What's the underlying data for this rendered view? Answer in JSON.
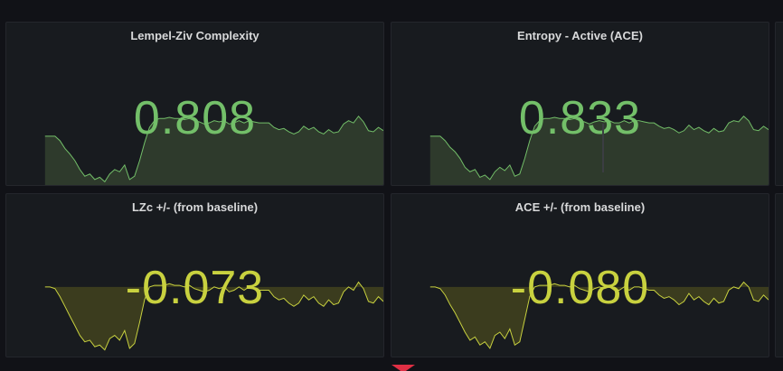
{
  "panels": {
    "lzc": {
      "title": "Lempel-Ziv Complexity",
      "value": "0.808",
      "color": "#73bf69",
      "fill": "#2e3a2c",
      "series": [
        0.44,
        0.44,
        0.44,
        0.4,
        0.33,
        0.28,
        0.22,
        0.14,
        0.08,
        0.1,
        0.05,
        0.07,
        0.03,
        0.1,
        0.14,
        0.12,
        0.18,
        0.05,
        0.08,
        0.22,
        0.38,
        0.52,
        0.58,
        0.6,
        0.6,
        0.61,
        0.6,
        0.6,
        0.59,
        0.6,
        0.58,
        0.57,
        0.55,
        0.56,
        0.58,
        0.57,
        0.58,
        0.55,
        0.56,
        0.58,
        0.56,
        0.58,
        0.57,
        0.56,
        0.56,
        0.56,
        0.52,
        0.5,
        0.51,
        0.48,
        0.46,
        0.48,
        0.53,
        0.5,
        0.52,
        0.48,
        0.46,
        0.5,
        0.47,
        0.48,
        0.55,
        0.58,
        0.56,
        0.62,
        0.57,
        0.49,
        0.48,
        0.52,
        0.49
      ]
    },
    "ace": {
      "title": "Entropy - Active (ACE)",
      "value": "0.833",
      "color": "#73bf69",
      "fill": "#2e3a2c",
      "series": [
        0.44,
        0.44,
        0.44,
        0.4,
        0.34,
        0.3,
        0.24,
        0.16,
        0.12,
        0.14,
        0.07,
        0.09,
        0.05,
        0.12,
        0.16,
        0.13,
        0.18,
        0.08,
        0.1,
        0.24,
        0.4,
        0.53,
        0.58,
        0.6,
        0.6,
        0.61,
        0.6,
        0.6,
        0.59,
        0.6,
        0.58,
        0.57,
        0.55,
        0.57,
        0.58,
        0.57,
        0.58,
        0.56,
        0.56,
        0.58,
        0.56,
        0.58,
        0.58,
        0.57,
        0.56,
        0.56,
        0.53,
        0.51,
        0.52,
        0.5,
        0.47,
        0.49,
        0.54,
        0.5,
        0.52,
        0.49,
        0.47,
        0.51,
        0.48,
        0.49,
        0.56,
        0.58,
        0.57,
        0.62,
        0.58,
        0.5,
        0.49,
        0.53,
        0.5
      ]
    },
    "lzc_delta": {
      "title": "LZc +/- (from baseline)",
      "value": "-0.073",
      "color": "#c8d13f",
      "fill": "#3b3c1e",
      "baseline": 0.0,
      "series": [
        0.0,
        0.0,
        -0.01,
        -0.06,
        -0.12,
        -0.18,
        -0.24,
        -0.3,
        -0.34,
        -0.33,
        -0.37,
        -0.36,
        -0.39,
        -0.32,
        -0.3,
        -0.33,
        -0.27,
        -0.38,
        -0.35,
        -0.22,
        -0.08,
        0.0,
        0.01,
        0.01,
        0.01,
        0.02,
        0.01,
        0.01,
        0.0,
        0.01,
        -0.01,
        -0.02,
        -0.03,
        -0.02,
        0.0,
        -0.01,
        0.0,
        -0.03,
        -0.02,
        0.0,
        -0.02,
        0.0,
        -0.01,
        -0.02,
        -0.02,
        -0.02,
        -0.06,
        -0.08,
        -0.07,
        -0.1,
        -0.12,
        -0.1,
        -0.05,
        -0.08,
        -0.06,
        -0.1,
        -0.12,
        -0.08,
        -0.11,
        -0.1,
        -0.03,
        0.0,
        -0.02,
        0.03,
        -0.01,
        -0.09,
        -0.1,
        -0.06,
        -0.09
      ]
    },
    "ace_delta": {
      "title": "ACE +/- (from baseline)",
      "value": "-0.080",
      "color": "#c8d13f",
      "fill": "#3b3c1e",
      "baseline": 0.0,
      "series": [
        0.0,
        0.0,
        -0.01,
        -0.05,
        -0.11,
        -0.16,
        -0.22,
        -0.28,
        -0.33,
        -0.31,
        -0.36,
        -0.34,
        -0.38,
        -0.3,
        -0.28,
        -0.32,
        -0.26,
        -0.36,
        -0.34,
        -0.2,
        -0.06,
        0.0,
        0.01,
        0.01,
        0.01,
        0.02,
        0.01,
        0.01,
        0.0,
        0.01,
        -0.01,
        -0.02,
        -0.03,
        -0.01,
        0.0,
        -0.01,
        0.0,
        -0.02,
        -0.02,
        0.0,
        -0.02,
        0.0,
        0.0,
        -0.01,
        -0.02,
        -0.02,
        -0.05,
        -0.07,
        -0.06,
        -0.08,
        -0.11,
        -0.09,
        -0.04,
        -0.08,
        -0.06,
        -0.09,
        -0.11,
        -0.07,
        -0.1,
        -0.09,
        -0.02,
        0.0,
        -0.01,
        0.03,
        0.0,
        -0.08,
        -0.09,
        -0.05,
        -0.08
      ]
    }
  }
}
